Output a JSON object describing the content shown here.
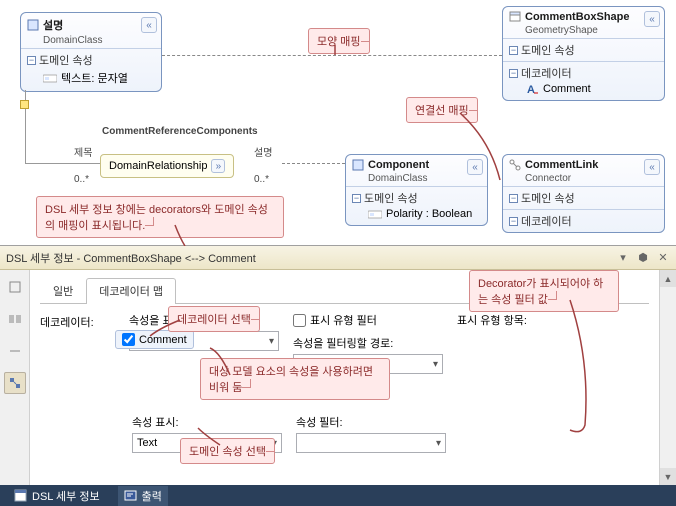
{
  "canvas": {
    "boxes": {
      "description": {
        "title": "설명",
        "subtitle": "DomainClass",
        "section": "도메인 속성",
        "prop": "텍스트: 문자열"
      },
      "commentBoxShape": {
        "title": "CommentBoxShape",
        "subtitle": "GeometryShape",
        "section1": "도메인 속성",
        "section2": "데코레이터",
        "prop": "Comment"
      },
      "component": {
        "title": "Component",
        "subtitle": "DomainClass",
        "section": "도메인 속성",
        "prop": "Polarity : Boolean"
      },
      "commentLink": {
        "title": "CommentLink",
        "subtitle": "Connector",
        "section1": "도메인 속성",
        "section2": "데코레이터"
      }
    },
    "relationship": {
      "header": "CommentReferenceComponents",
      "left_label": "제목",
      "right_label": "설명",
      "left_mult": "0..*",
      "right_mult": "0..*",
      "name": "DomainRelationship"
    },
    "callouts": {
      "shape_map": "모양 매핑",
      "conn_map": "연결선 매핑",
      "dsl_info": "DSL 세부 정보 창에는 decorators와 도메인 속성의 매핑이 표시됩니다."
    }
  },
  "dsl": {
    "title": "DSL 세부 정보 - CommentBoxShape <--> Comment",
    "tabs": {
      "general": "일반",
      "decorator_map": "데코레이터 맵"
    },
    "labels": {
      "decorator": "데코레이터:",
      "display_path": "속성을 표시할 경로:",
      "filter_path": "속성을 필터링할 경로:",
      "display_prop": "속성 표시:",
      "filter_prop": "속성 필터:",
      "visibility_filter": "표시 유형 필터",
      "visibility_items": "표시 유형 항목:"
    },
    "values": {
      "comment": "Comment",
      "text": "Text"
    },
    "callouts": {
      "select_decorator": "데코레이터 선택",
      "empty_hint": "대상 모델 요소의 속성을 사용하려면 비워 둠",
      "select_domain_prop": "도메인 속성 선택",
      "decorator_filter": "Decorator가 표시되어야 하는 속성 필터 값"
    }
  },
  "status": {
    "dsl_detail": "DSL 세부 정보",
    "output": "출력"
  }
}
